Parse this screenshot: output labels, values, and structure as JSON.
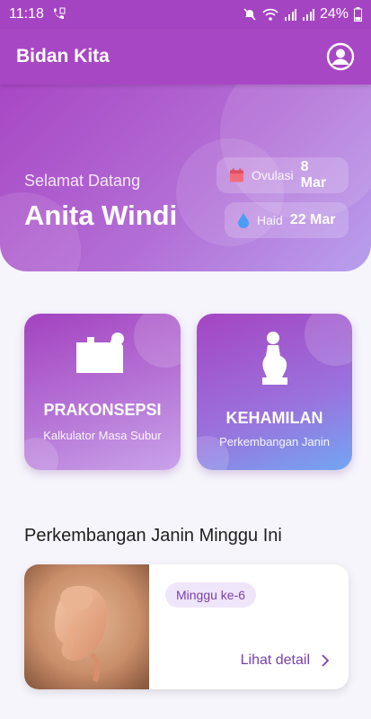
{
  "status_bar": {
    "time": "11:18",
    "battery": "24%",
    "icons": [
      "call-forward-icon",
      "mute-icon",
      "wifi-icon",
      "signal-icon",
      "signal-icon",
      "battery-icon"
    ]
  },
  "app_bar": {
    "title": "Bidan Kita",
    "profile_icon": "account-circle-icon"
  },
  "hero": {
    "greeting": "Selamat Datang",
    "user_name": "Anita Windi",
    "ovulation": {
      "label": "Ovulasi",
      "value": "8 Mar",
      "icon": "calendar-icon"
    },
    "period": {
      "label": "Haid",
      "value": "22 Mar",
      "icon": "drop-icon"
    }
  },
  "menu": [
    {
      "title": "PRAKONSEPSI",
      "subtitle": "Kalkulator Masa Subur",
      "icon": "couple-bed-icon"
    },
    {
      "title": "KEHAMILAN",
      "subtitle": "Perkembangan Janin",
      "icon": "pregnant-woman-icon"
    }
  ],
  "section": {
    "title": "Perkembangan Janin Minggu Ini"
  },
  "fetal_card": {
    "week": "Minggu ke-6",
    "link": "Lihat detail",
    "image": "fetus-image"
  },
  "colors": {
    "primary": "#a847c4",
    "accent_text": "#7b3fae",
    "calendar_icon": "#f26b7b",
    "drop_icon": "#4b9cf5"
  }
}
